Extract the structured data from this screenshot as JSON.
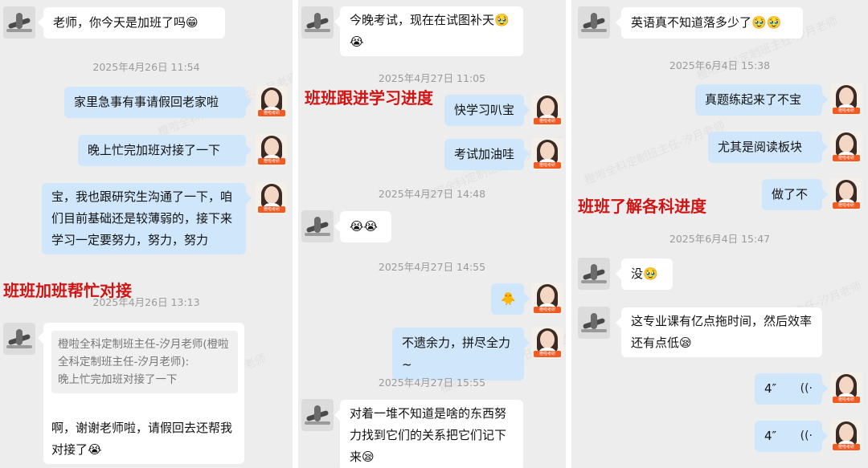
{
  "panel1": {
    "msg1": "老师，你今天是加班了吗😁",
    "ts1": "2025年4月26日  11:54",
    "msg2": "家里急事有事请假回老家啦",
    "msg3": "晚上忙完加班对接了一下",
    "msg4": "宝，我也跟研究生沟通了一下，咱们目前基础还是较薄弱的，接下来学习一定要努力，努力，努力",
    "overlay": "班班加班帮忙对接",
    "ts2": "2025年4月26日  13:13",
    "quote": "橙啦全科定制班主任-汐月老师(橙啦全科定制班主任-汐月老师):\n晚上忙完加班对接了一下",
    "msg5": "啊，谢谢老师啦，请假回去还帮我对接了😭"
  },
  "panel2": {
    "msg1": "今晚考试，现在在试图补天🥹😭",
    "ts1": "2025年4月27日  11:05",
    "overlay": "班班跟进学习进度",
    "msg2": "快学习叭宝",
    "msg3": "考试加油哇",
    "ts2": "2025年4月27日  14:48",
    "msg4": "😭😭",
    "ts3": "2025年4月27日  14:55",
    "msg5": "🐥",
    "msg6": "不遗余力，拼尽全力~",
    "ts4": "2025年4月27日  15:55",
    "msg7": "对着一堆不知道是啥的东西努力找到它们的关系把它们记下来😪"
  },
  "panel3": {
    "msg1": "英语真不知道落多少了🥹🥹",
    "ts1": "2025年6月4日  15:38",
    "msg2": "真题练起来了不宝",
    "msg3": "尤其是阅读板块",
    "overlay": "班班了解各科进度",
    "msg4": "做了不",
    "ts2": "2025年6月4日  15:47",
    "msg5": "没🥹",
    "msg6": "这专业课有亿点拖时间，然后效率还有点低😪",
    "voice1_duration": "4″",
    "voice2_duration": "4″"
  },
  "avatar_tag": "橙啦考研",
  "watermark": "橙啦全科定制班主任-汐月老师",
  "icons": {
    "voice": "voice-wave-icon",
    "teacher_avatar": "teacher-avatar-icon",
    "student_avatar": "student-avatar-icon"
  },
  "colors": {
    "background": "#ededed",
    "bubble_left": "#ffffff",
    "bubble_right": "#cfe6fb",
    "overlay_red": "#d01414",
    "timestamp": "#9b9b9b"
  }
}
